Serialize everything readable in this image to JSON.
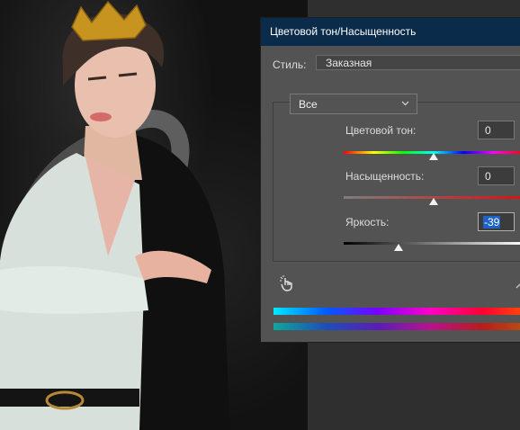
{
  "dialog": {
    "title": "Цветовой тон/Насыщенность",
    "style_label": "Стиль:",
    "style_value": "Заказная",
    "channel_value": "Все",
    "hue": {
      "label": "Цветовой тон:",
      "value": "0",
      "slider_fraction": 0.5
    },
    "saturation": {
      "label": "Насыщенность:",
      "value": "0",
      "slider_fraction": 0.5
    },
    "lightness": {
      "label": "Яркость:",
      "value": "-39",
      "slider_fraction": 0.305
    }
  },
  "icons": {
    "target_adjust": "hand-pointer-icon",
    "eyedropper": "eyedropper-icon",
    "channel_chevron": "chevron-down-icon"
  }
}
